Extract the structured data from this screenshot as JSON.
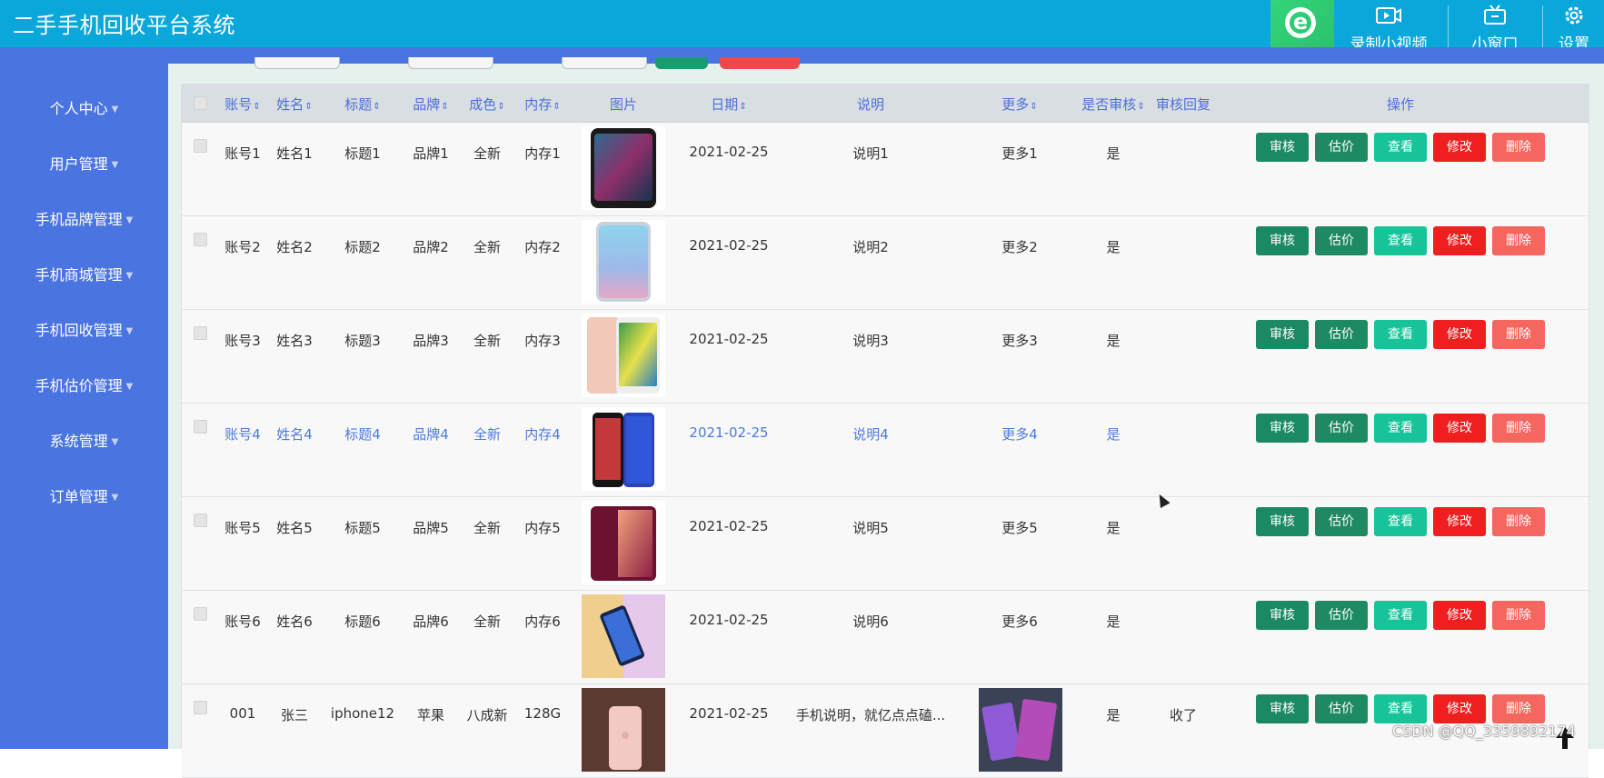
{
  "app": {
    "title": "二手手机回收平台系统"
  },
  "toolbar": {
    "record_label": "录制小视频",
    "window_label": "小窗口",
    "settings_label": "设置"
  },
  "sidebar": {
    "items": [
      {
        "label": "个人中心"
      },
      {
        "label": "用户管理"
      },
      {
        "label": "手机品牌管理"
      },
      {
        "label": "手机商城管理"
      },
      {
        "label": "手机回收管理"
      },
      {
        "label": "手机估价管理"
      },
      {
        "label": "系统管理"
      },
      {
        "label": "订单管理"
      }
    ]
  },
  "table": {
    "headers": {
      "account": "账号",
      "name": "姓名",
      "title": "标题",
      "brand": "品牌",
      "condition": "成色",
      "memory": "内存",
      "image": "图片",
      "date": "日期",
      "desc": "说明",
      "more": "更多",
      "audited": "是否审核",
      "reply": "审核回复",
      "ops": "操作"
    },
    "rows": [
      {
        "account": "账号1",
        "name": "姓名1",
        "title": "标题1",
        "brand": "品牌1",
        "condition": "全新",
        "memory": "内存1",
        "date": "2021-02-25",
        "desc": "说明1",
        "more": "更多1",
        "audited": "是",
        "reply": ""
      },
      {
        "account": "账号2",
        "name": "姓名2",
        "title": "标题2",
        "brand": "品牌2",
        "condition": "全新",
        "memory": "内存2",
        "date": "2021-02-25",
        "desc": "说明2",
        "more": "更多2",
        "audited": "是",
        "reply": ""
      },
      {
        "account": "账号3",
        "name": "姓名3",
        "title": "标题3",
        "brand": "品牌3",
        "condition": "全新",
        "memory": "内存3",
        "date": "2021-02-25",
        "desc": "说明3",
        "more": "更多3",
        "audited": "是",
        "reply": ""
      },
      {
        "account": "账号4",
        "name": "姓名4",
        "title": "标题4",
        "brand": "品牌4",
        "condition": "全新",
        "memory": "内存4",
        "date": "2021-02-25",
        "desc": "说明4",
        "more": "更多4",
        "audited": "是",
        "reply": ""
      },
      {
        "account": "账号5",
        "name": "姓名5",
        "title": "标题5",
        "brand": "品牌5",
        "condition": "全新",
        "memory": "内存5",
        "date": "2021-02-25",
        "desc": "说明5",
        "more": "更多5",
        "audited": "是",
        "reply": ""
      },
      {
        "account": "账号6",
        "name": "姓名6",
        "title": "标题6",
        "brand": "品牌6",
        "condition": "全新",
        "memory": "内存6",
        "date": "2021-02-25",
        "desc": "说明6",
        "more": "更多6",
        "audited": "是",
        "reply": ""
      },
      {
        "account": "001",
        "name": "张三",
        "title": "iphone12",
        "brand": "苹果",
        "condition": "八成新",
        "memory": "128G",
        "date": "2021-02-25",
        "desc": "手机说明，就亿点点磕...",
        "more": "",
        "audited": "是",
        "reply": "收了"
      }
    ],
    "buttons": {
      "audit": "审核",
      "price": "估价",
      "view": "查看",
      "edit": "修改",
      "delete": "删除"
    }
  },
  "watermark": "CSDN @QQ_3359892174",
  "colors": {
    "topbar": "#0aa8da",
    "sidebar": "#4a74e0",
    "header_text": "#4d6fd8",
    "btn_audit": "#1b8a64",
    "btn_view": "#17c49a",
    "btn_edit": "#f01f1f",
    "btn_delete": "#f4665e"
  }
}
